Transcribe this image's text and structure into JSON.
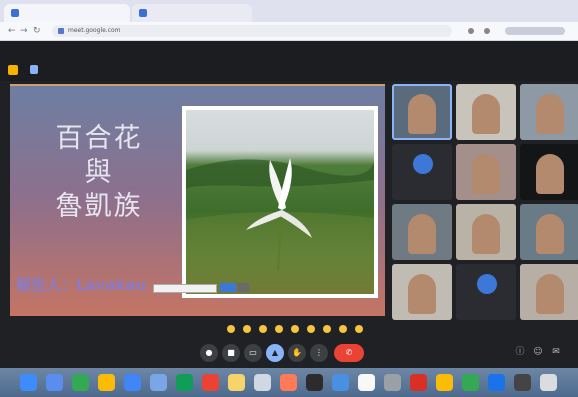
{
  "browser": {
    "tabs": [
      {
        "label": ""
      },
      {
        "label": ""
      }
    ],
    "url": "meet.google.com"
  },
  "meeting": {
    "title": ""
  },
  "slide": {
    "title_line1": "百合花",
    "title_line2": "與",
    "title_line3": "魯凱族",
    "presenter": "報告人：Lavakau",
    "caption_buttons": [
      "",
      ""
    ]
  },
  "participants": [
    {
      "name": "",
      "type": "video",
      "color": "#5a6b7d"
    },
    {
      "name": "",
      "type": "video",
      "color": "#c8c3bb"
    },
    {
      "name": "",
      "type": "video",
      "color": "#8d9aa6"
    },
    {
      "name": "",
      "type": "avatar",
      "color": "#2a2c31",
      "initial": ""
    },
    {
      "name": "",
      "type": "video",
      "color": "#a58f8a"
    },
    {
      "name": "",
      "type": "video",
      "color": "#141517"
    },
    {
      "name": "",
      "type": "video",
      "color": "#6f7a82"
    },
    {
      "name": "",
      "type": "video",
      "color": "#b9b3a7"
    },
    {
      "name": "",
      "type": "video",
      "color": "#6a7b88"
    },
    {
      "name": "",
      "type": "video",
      "color": "#c0bcb3"
    },
    {
      "name": "",
      "type": "avatar",
      "color": "#2a2c31",
      "initial": ""
    },
    {
      "name": "",
      "type": "video",
      "color": "#b7afa6"
    }
  ],
  "toolbar": {
    "time_and_code": "",
    "controls": [
      "mic",
      "camera",
      "captions",
      "present",
      "raise-hand",
      "more",
      "end-call"
    ]
  },
  "colors": {
    "accent": "#8ab4f8",
    "end_call": "#ea4335",
    "background": "#202124"
  }
}
